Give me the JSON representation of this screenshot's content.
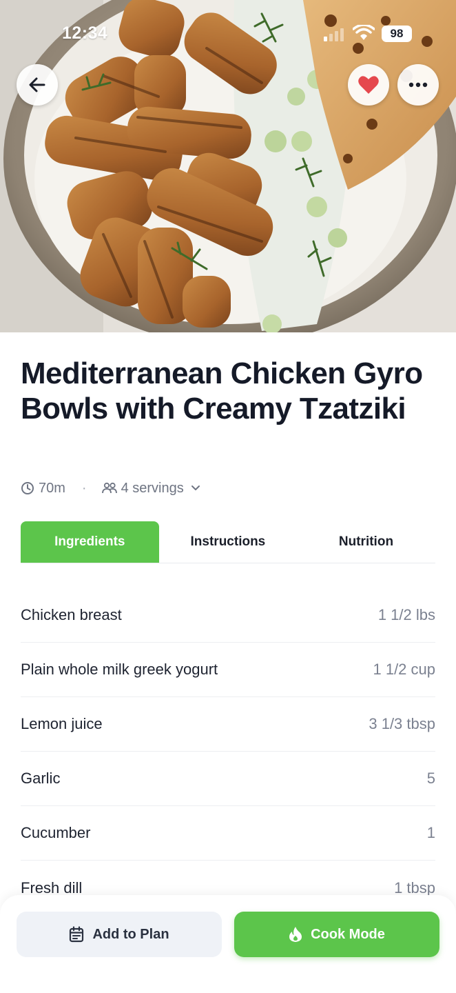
{
  "status_bar": {
    "time": "12:34",
    "battery": "98",
    "icons": [
      "signal-icon",
      "wifi-icon",
      "battery-icon"
    ]
  },
  "header": {
    "back_icon": "arrow-left-icon",
    "favorite_icon": "heart-icon",
    "favorite_color": "#e5484d",
    "more_icon": "ellipsis-icon"
  },
  "recipe": {
    "title": "Mediterranean Chicken Gyro Bowls with Creamy Tzatziki",
    "time": "70m",
    "servings": "4 servings"
  },
  "tabs": [
    {
      "label": "Ingredients",
      "active": true
    },
    {
      "label": "Instructions",
      "active": false
    },
    {
      "label": "Nutrition",
      "active": false
    }
  ],
  "ingredients": [
    {
      "name": "Chicken breast",
      "qty": "1 1/2 lbs"
    },
    {
      "name": "Plain whole milk greek yogurt",
      "qty": "1 1/2 cup"
    },
    {
      "name": "Lemon juice",
      "qty": "3 1/3 tbsp"
    },
    {
      "name": "Garlic",
      "qty": "5"
    },
    {
      "name": "Cucumber",
      "qty": "1"
    },
    {
      "name": "Fresh dill",
      "qty": "1 tbsp"
    }
  ],
  "actions": {
    "add_to_plan": "Add to Plan",
    "cook_mode": "Cook Mode"
  },
  "colors": {
    "accent": "#5cc54b",
    "title": "#151a28",
    "muted": "#6e7482"
  }
}
